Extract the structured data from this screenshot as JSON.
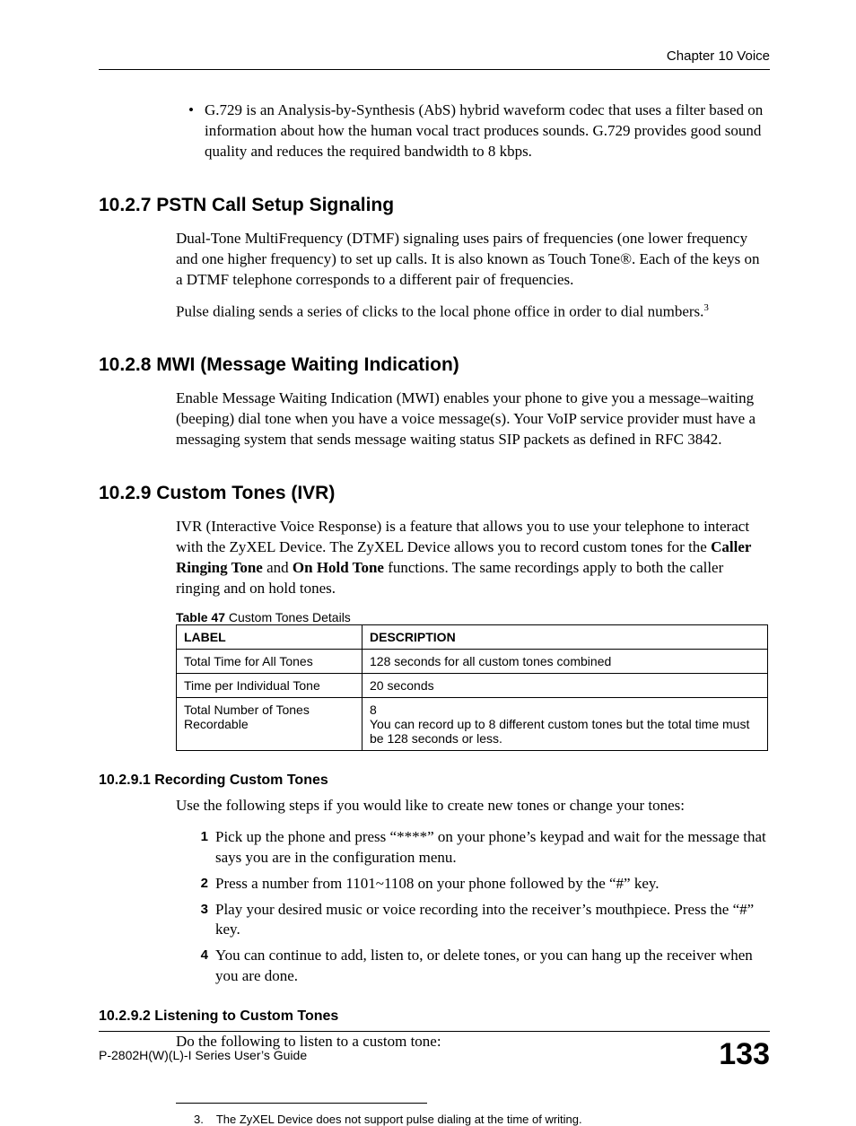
{
  "chapter_header": "Chapter 10 Voice",
  "bullet_intro": "G.729 is an Analysis-by-Synthesis (AbS) hybrid waveform codec that uses a filter based on information about how the human vocal tract produces sounds. G.729 provides good sound quality and reduces the required bandwidth to 8 kbps.",
  "s1027": {
    "heading": "10.2.7  PSTN Call Setup Signaling",
    "p1": "Dual-Tone MultiFrequency (DTMF) signaling uses pairs of frequencies (one lower frequency and one higher frequency) to set up calls. It is also known as Touch Tone®. Each of the keys on a DTMF telephone corresponds to a different pair of frequencies.",
    "p2_pre": "Pulse dialing sends a series of clicks to the local phone office in order to dial numbers.",
    "p2_sup": "3"
  },
  "s1028": {
    "heading": "10.2.8  MWI (Message Waiting Indication)",
    "p1": "Enable Message Waiting Indication (MWI) enables your phone to give you a message–waiting (beeping) dial tone when you have a voice message(s). Your VoIP service provider must have a messaging system that sends message waiting status SIP packets as defined in RFC 3842."
  },
  "s1029": {
    "heading": "10.2.9  Custom Tones (IVR)",
    "p1_a": "IVR (Interactive Voice Response) is a feature that allows you to use your telephone to interact with the ZyXEL Device. The ZyXEL Device allows you to record custom tones for the ",
    "p1_b": "Caller Ringing Tone",
    "p1_c": " and ",
    "p1_d": "On Hold Tone",
    "p1_e": " functions. The same recordings apply to both the caller ringing and on hold tones.",
    "table_caption_bold": "Table 47",
    "table_caption_rest": "   Custom Tones Details",
    "th_label": "LABEL",
    "th_desc": "DESCRIPTION",
    "rows": [
      {
        "label": "Total Time for All Tones",
        "desc": "128 seconds for all custom tones combined"
      },
      {
        "label": "Time per Individual Tone",
        "desc": "20 seconds"
      },
      {
        "label": "Total Number of Tones Recordable",
        "desc": "8\nYou can record up to 8 different custom tones but the total time must be 128 seconds or less."
      }
    ]
  },
  "s10291": {
    "heading": "10.2.9.1  Recording Custom Tones",
    "intro": "Use the following steps if you would like to create new tones or change your tones:",
    "steps": [
      "Pick up the phone and press “****” on your phone’s keypad and wait for the message that says you are in the configuration menu.",
      "Press a number from 1101~1108 on your phone followed by the “#” key.",
      "Play your desired music or voice recording into the receiver’s mouthpiece. Press the “#” key.",
      "You can continue to add, listen to, or delete tones, or you can hang up the receiver when you are done."
    ]
  },
  "s10292": {
    "heading": "10.2.9.2  Listening to Custom Tones",
    "intro": "Do the following to listen to a custom tone:"
  },
  "footnote": {
    "num": "3.",
    "text": "The ZyXEL Device does not support pulse dialing at the time of writing."
  },
  "footer": {
    "guide": "P-2802H(W)(L)-I Series User’s Guide",
    "page": "133"
  }
}
